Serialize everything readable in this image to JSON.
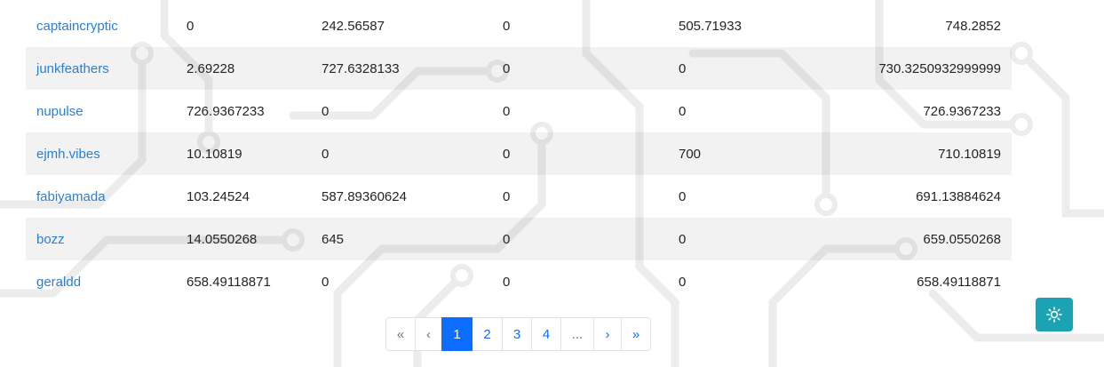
{
  "table": {
    "rows": [
      {
        "user": "captaincryptic",
        "c1": "0",
        "c2": "242.56587",
        "c3": "0",
        "c4": "505.71933",
        "total": "748.2852"
      },
      {
        "user": "junkfeathers",
        "c1": "2.69228",
        "c2": "727.6328133",
        "c3": "0",
        "c4": "0",
        "total": "730.3250932999999"
      },
      {
        "user": "nupulse",
        "c1": "726.9367233",
        "c2": "0",
        "c3": "0",
        "c4": "0",
        "total": "726.9367233"
      },
      {
        "user": "ejmh.vibes",
        "c1": "10.10819",
        "c2": "0",
        "c3": "0",
        "c4": "700",
        "total": "710.10819"
      },
      {
        "user": "fabiyamada",
        "c1": "103.24524",
        "c2": "587.89360624",
        "c3": "0",
        "c4": "0",
        "total": "691.13884624"
      },
      {
        "user": "bozz",
        "c1": "14.0550268",
        "c2": "645",
        "c3": "0",
        "c4": "0",
        "total": "659.0550268"
      },
      {
        "user": "geraldd",
        "c1": "658.49118871",
        "c2": "0",
        "c3": "0",
        "c4": "0",
        "total": "658.49118871"
      }
    ]
  },
  "pagination": {
    "first": "«",
    "prev": "‹",
    "pages": [
      "1",
      "2",
      "3",
      "4"
    ],
    "ellipsis": "...",
    "next": "›",
    "last": "»",
    "active_page": "1"
  },
  "theme_toggle": {
    "icon": "sun-icon"
  },
  "colors": {
    "link": "#2a80d0",
    "active_page": "#0d6efd",
    "theme_button": "#1ba2b3",
    "stripe": "#f2f2f2"
  }
}
